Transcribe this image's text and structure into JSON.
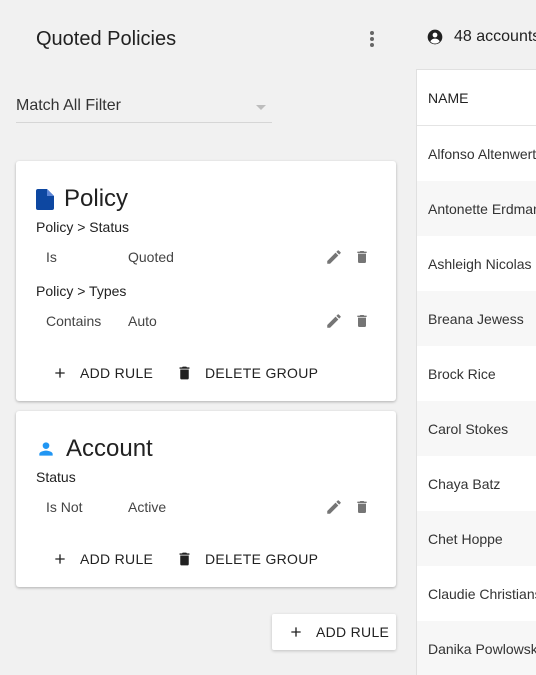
{
  "panel": {
    "title": "Quoted Policies",
    "menu_icon": "more-vert-icon"
  },
  "filter": {
    "selected": "Match All Filter"
  },
  "groups": [
    {
      "title": "Policy",
      "icon": "document-icon",
      "icon_color": "#0d47a1",
      "rules": [
        {
          "label": "Policy > Status",
          "operator": "Is",
          "value": "Quoted"
        },
        {
          "label": "Policy > Types",
          "operator": "Contains",
          "value": "Auto"
        }
      ],
      "add_rule_label": "ADD RULE",
      "delete_group_label": "DELETE GROUP"
    },
    {
      "title": "Account",
      "icon": "person-icon",
      "icon_color": "#2196f3",
      "rules": [
        {
          "label": "Status",
          "operator": "Is Not",
          "value": "Active"
        }
      ],
      "add_rule_label": "ADD RULE",
      "delete_group_label": "DELETE GROUP"
    }
  ],
  "add_rule_button": {
    "label": "ADD RULE"
  },
  "accounts": {
    "count_label": "48 accounts",
    "column_header": "NAME",
    "rows": [
      "Alfonso Altenwerth",
      "Antonette Erdman",
      "Ashleigh Nicolas",
      "Breana Jewess",
      "Brock Rice",
      "Carol Stokes",
      "Chaya Batz",
      "Chet Hoppe",
      "Claudie Christiansen",
      "Danika Powlowski"
    ]
  }
}
